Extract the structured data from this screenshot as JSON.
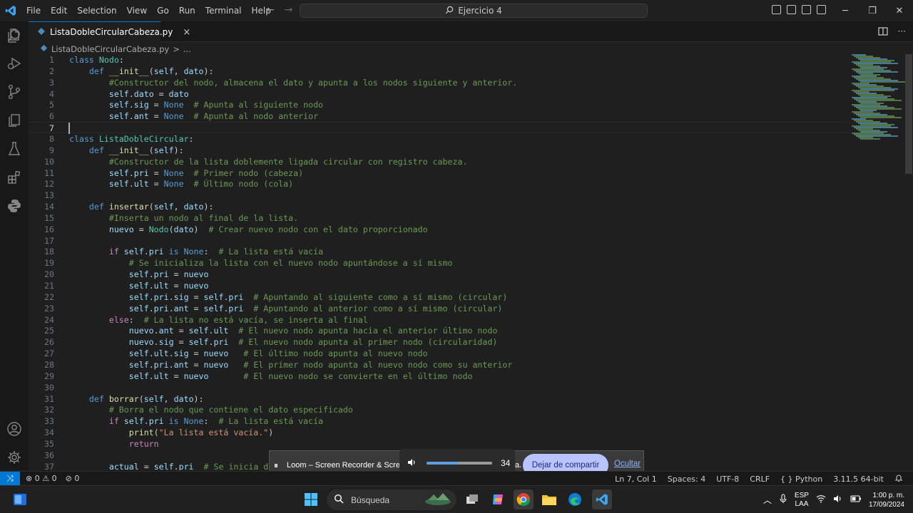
{
  "menu": [
    "File",
    "Edit",
    "Selection",
    "View",
    "Go",
    "Run",
    "Terminal",
    "Help"
  ],
  "command_center": "Ejercicio 4",
  "tab": {
    "label": "ListaDobleCircularCabeza.py",
    "close": "×"
  },
  "breadcrumb": {
    "file": "ListaDobleCircularCabeza.py",
    "sep": ">",
    "rest": "..."
  },
  "code_lines": [
    {
      "n": "1",
      "html": "<span class='kw'>class</span> <span class='cls'>Nodo</span>:"
    },
    {
      "n": "2",
      "html": "    <span class='kw'>def</span> <span class='fn'>__init__</span>(<span class='var'>self</span>, <span class='var'>dato</span>):"
    },
    {
      "n": "3",
      "html": "        <span class='cm'>#Constructor del nodo, almacena el dato y apunta a los nodos siguiente y anterior.</span>"
    },
    {
      "n": "4",
      "html": "        <span class='var'>self</span>.<span class='var'>dato</span> = <span class='var'>dato</span>"
    },
    {
      "n": "5",
      "html": "        <span class='var'>self</span>.<span class='var'>sig</span> = <span class='kw'>None</span>  <span class='cm'># Apunta al siguiente nodo</span>"
    },
    {
      "n": "6",
      "html": "        <span class='var'>self</span>.<span class='var'>ant</span> = <span class='kw'>None</span>  <span class='cm'># Apunta al nodo anterior</span>"
    },
    {
      "n": "7",
      "html": "",
      "current": true
    },
    {
      "n": "8",
      "html": "<span class='kw'>class</span> <span class='cls'>ListaDobleCircular</span>:"
    },
    {
      "n": "9",
      "html": "    <span class='kw'>def</span> <span class='fn'>__init__</span>(<span class='var'>self</span>):"
    },
    {
      "n": "10",
      "html": "        <span class='cm'>#Constructor de la lista doblemente ligada circular con registro cabeza.</span>"
    },
    {
      "n": "11",
      "html": "        <span class='var'>self</span>.<span class='var'>pri</span> = <span class='kw'>None</span>  <span class='cm'># Primer nodo (cabeza)</span>"
    },
    {
      "n": "12",
      "html": "        <span class='var'>self</span>.<span class='var'>ult</span> = <span class='kw'>None</span>  <span class='cm'># Último nodo (cola)</span>"
    },
    {
      "n": "13",
      "html": ""
    },
    {
      "n": "14",
      "html": "    <span class='kw'>def</span> <span class='fn'>insertar</span>(<span class='var'>self</span>, <span class='var'>dato</span>):"
    },
    {
      "n": "15",
      "html": "        <span class='cm'>#Inserta un nodo al final de la lista.</span>"
    },
    {
      "n": "16",
      "html": "        <span class='var'>nuevo</span> = <span class='cls'>Nodo</span>(<span class='var'>dato</span>)  <span class='cm'># Crear nuevo nodo con el dato proporcionado</span>"
    },
    {
      "n": "17",
      "html": ""
    },
    {
      "n": "18",
      "html": "        <span class='kw2'>if</span> <span class='var'>self</span>.<span class='var'>pri</span> <span class='kw'>is</span> <span class='kw'>None</span>:  <span class='cm'># La lista está vacía</span>"
    },
    {
      "n": "19",
      "html": "            <span class='cm'># Se inicializa la lista con el nuevo nodo apuntándose a sí mismo</span>"
    },
    {
      "n": "20",
      "html": "            <span class='var'>self</span>.<span class='var'>pri</span> = <span class='var'>nuevo</span>"
    },
    {
      "n": "21",
      "html": "            <span class='var'>self</span>.<span class='var'>ult</span> = <span class='var'>nuevo</span>"
    },
    {
      "n": "22",
      "html": "            <span class='var'>self</span>.<span class='var'>pri</span>.<span class='var'>sig</span> = <span class='var'>self</span>.<span class='var'>pri</span>  <span class='cm'># Apuntando al siguiente como a sí mismo (circular)</span>"
    },
    {
      "n": "23",
      "html": "            <span class='var'>self</span>.<span class='var'>pri</span>.<span class='var'>ant</span> = <span class='var'>self</span>.<span class='var'>pri</span>  <span class='cm'># Apuntando al anterior como a sí mismo (circular)</span>"
    },
    {
      "n": "24",
      "html": "        <span class='kw2'>else</span>:  <span class='cm'># La lista no está vacía, se inserta al final</span>"
    },
    {
      "n": "25",
      "html": "            <span class='var'>nuevo</span>.<span class='var'>ant</span> = <span class='var'>self</span>.<span class='var'>ult</span>  <span class='cm'># El nuevo nodo apunta hacia el anterior último nodo</span>"
    },
    {
      "n": "26",
      "html": "            <span class='var'>nuevo</span>.<span class='var'>sig</span> = <span class='var'>self</span>.<span class='var'>pri</span>  <span class='cm'># El nuevo nodo apunta al primer nodo (circularidad)</span>"
    },
    {
      "n": "27",
      "html": "            <span class='var'>self</span>.<span class='var'>ult</span>.<span class='var'>sig</span> = <span class='var'>nuevo</span>   <span class='cm'># El último nodo apunta al nuevo nodo</span>"
    },
    {
      "n": "28",
      "html": "            <span class='var'>self</span>.<span class='var'>pri</span>.<span class='var'>ant</span> = <span class='var'>nuevo</span>   <span class='cm'># El primer nodo apunta al nuevo nodo como su anterior</span>"
    },
    {
      "n": "29",
      "html": "            <span class='var'>self</span>.<span class='var'>ult</span> = <span class='var'>nuevo</span>       <span class='cm'># El nuevo nodo se convierte en el último nodo</span>"
    },
    {
      "n": "30",
      "html": ""
    },
    {
      "n": "31",
      "html": "    <span class='kw'>def</span> <span class='fn'>borrar</span>(<span class='var'>self</span>, <span class='var'>dato</span>):"
    },
    {
      "n": "32",
      "html": "        <span class='cm'># Borra el nodo que contiene el dato especificado</span>"
    },
    {
      "n": "33",
      "html": "        <span class='kw2'>if</span> <span class='var'>self</span>.<span class='var'>pri</span> <span class='kw'>is</span> <span class='kw'>None</span>:  <span class='cm'># La lista está vacía</span>"
    },
    {
      "n": "34",
      "html": "            <span class='fn'>print</span>(<span class='str'>\"La lista está vacía.\"</span>)"
    },
    {
      "n": "35",
      "html": "            <span class='kw2'>return</span>"
    },
    {
      "n": "36",
      "html": ""
    },
    {
      "n": "37",
      "html": "        <span class='var'>actual</span> = <span class='var'>self</span>.<span class='var'>pri</span>  <span class='cm'># Se inicia desde el primer nodo</span>"
    }
  ],
  "loom": {
    "pause": "⏸",
    "text": "Loom – Screen Recorder & Screen Capture",
    "tail": "a.",
    "volume_value": "34",
    "volume_level": 0.34,
    "stop_share": "Dejar de compartir",
    "hide": "Ocultar"
  },
  "statusbar": {
    "errors": "0",
    "warnings": "0",
    "ports": "0",
    "position": "Ln 7, Col 1",
    "spaces": "Spaces: 4",
    "encoding": "UTF-8",
    "eol": "CRLF",
    "language": "Python",
    "interpreter": "3.11.5 64-bit"
  },
  "taskbar": {
    "search": "Búsqueda",
    "lang_top": "ESP",
    "lang_bottom": "LAA",
    "time": "1:00 p. m.",
    "date": "17/09/2024"
  },
  "colors": {
    "accent": "#0078d4",
    "comment": "#6a9955",
    "keyword": "#569cd6"
  }
}
